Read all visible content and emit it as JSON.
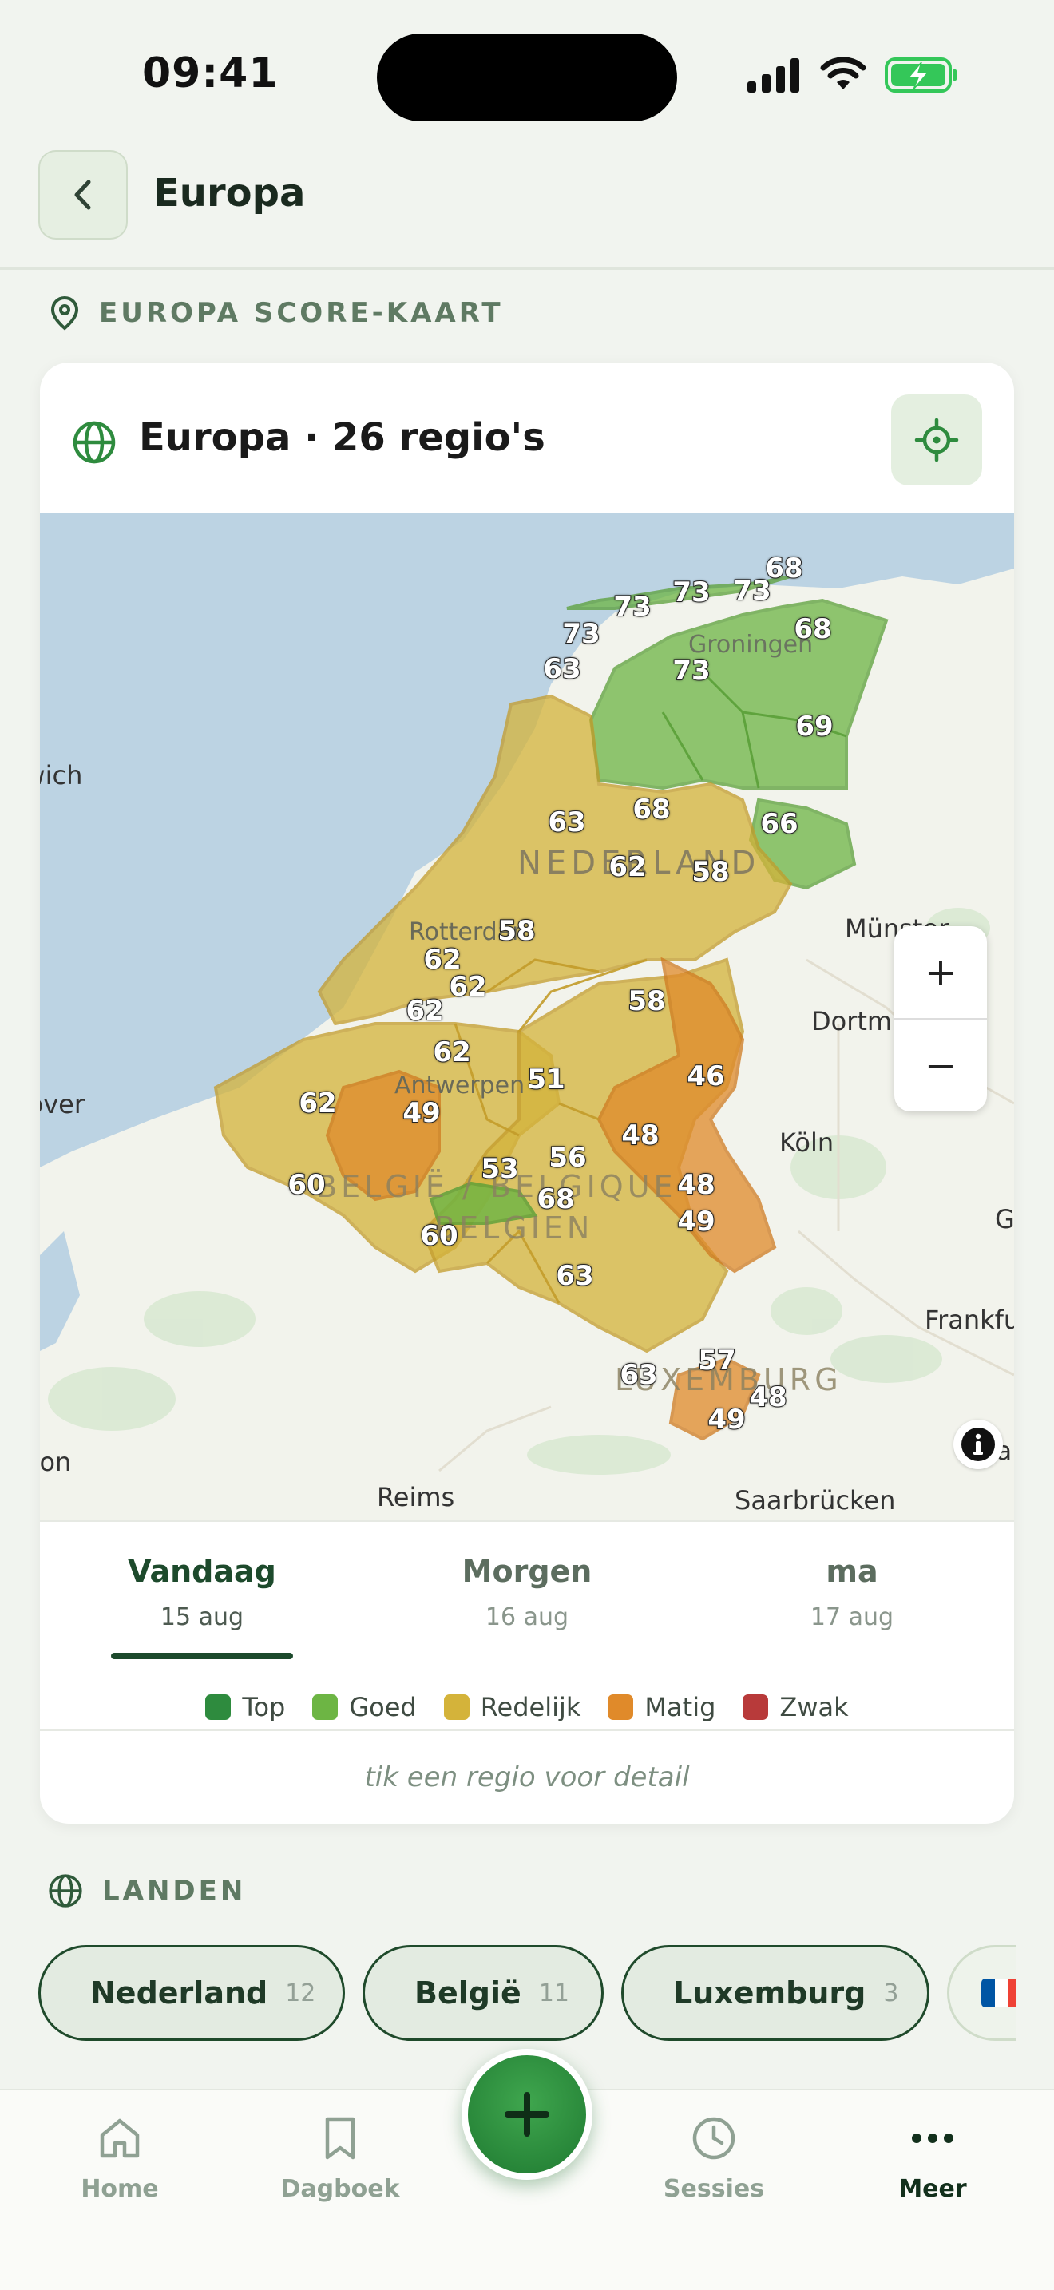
{
  "status_bar": {
    "time": "09:41"
  },
  "header": {
    "title": "Europa"
  },
  "map_section": {
    "label": "EUROPA SCORE-KAART"
  },
  "map_card": {
    "title": "Europa · 26 regio's",
    "place_labels": [
      {
        "id": "groningen",
        "text": "Groningen"
      },
      {
        "id": "nederland",
        "text": "NEDERLAND"
      },
      {
        "id": "rotterdam",
        "text": "Rotterdam"
      },
      {
        "id": "antwerpen",
        "text": "Antwerpen"
      },
      {
        "id": "belgie",
        "text": "BELGIË / BELGIQUE"
      },
      {
        "id": "belgien",
        "text": "BELGIEN"
      },
      {
        "id": "luxemburg",
        "text": "LUXEMBURG"
      },
      {
        "id": "munster",
        "text": "Münster"
      },
      {
        "id": "dortmund",
        "text": "Dortmund"
      },
      {
        "id": "koln",
        "text": "Köln"
      },
      {
        "id": "frankfurt",
        "text": "Frankfurt"
      },
      {
        "id": "saarbrucken",
        "text": "Saarbrücken"
      },
      {
        "id": "reims",
        "text": "Reims"
      },
      {
        "id": "ipswich",
        "text": "Ipswich"
      },
      {
        "id": "dover",
        "text": "Dover"
      },
      {
        "id": "london",
        "text": "London"
      },
      {
        "id": "g",
        "text": "G"
      },
      {
        "id": "mainz",
        "text": "Mainz"
      }
    ],
    "scores": [
      {
        "v": "73"
      },
      {
        "v": "73"
      },
      {
        "v": "73"
      },
      {
        "v": "68"
      },
      {
        "v": "73"
      },
      {
        "v": "68"
      },
      {
        "v": "63"
      },
      {
        "v": "73"
      },
      {
        "v": "69"
      },
      {
        "v": "63"
      },
      {
        "v": "68"
      },
      {
        "v": "66"
      },
      {
        "v": "62"
      },
      {
        "v": "58"
      },
      {
        "v": "58"
      },
      {
        "v": "62"
      },
      {
        "v": "62"
      },
      {
        "v": "62"
      },
      {
        "v": "58"
      },
      {
        "v": "62"
      },
      {
        "v": "51"
      },
      {
        "v": "46"
      },
      {
        "v": "62"
      },
      {
        "v": "49"
      },
      {
        "v": "48"
      },
      {
        "v": "56"
      },
      {
        "v": "53"
      },
      {
        "v": "60"
      },
      {
        "v": "68"
      },
      {
        "v": "48"
      },
      {
        "v": "60"
      },
      {
        "v": "49"
      },
      {
        "v": "63"
      },
      {
        "v": "57"
      },
      {
        "v": "63"
      },
      {
        "v": "48"
      },
      {
        "v": "49"
      }
    ],
    "zoom_in": "+",
    "zoom_out": "−"
  },
  "day_tabs": [
    {
      "name": "Vandaag",
      "date": "15 aug",
      "active": true
    },
    {
      "name": "Morgen",
      "date": "16 aug",
      "active": false
    },
    {
      "name": "ma",
      "date": "17 aug",
      "active": false
    }
  ],
  "legend": [
    {
      "label": "Top",
      "color": "#2e8b3e"
    },
    {
      "label": "Goed",
      "color": "#6db544"
    },
    {
      "label": "Redelijk",
      "color": "#d4b33a"
    },
    {
      "label": "Matig",
      "color": "#e08a2a"
    },
    {
      "label": "Zwak",
      "color": "#b83a3a"
    }
  ],
  "hint": "tik een regio voor detail",
  "countries_section": {
    "label": "LANDEN"
  },
  "countries": [
    {
      "name": "Nederland",
      "count": "12"
    },
    {
      "name": "België",
      "count": "11"
    },
    {
      "name": "Luxemburg",
      "count": "3"
    }
  ],
  "bottom_nav": {
    "home": "Home",
    "dagboek": "Dagboek",
    "sessies": "Sessies",
    "meer": "Meer"
  },
  "colors": {
    "top": "#2e8b3e",
    "goed": "#6db544",
    "redelijk": "#d4b33a",
    "matig": "#e08a2a",
    "zwak": "#b83a3a",
    "accent": "#1d4a2c"
  }
}
